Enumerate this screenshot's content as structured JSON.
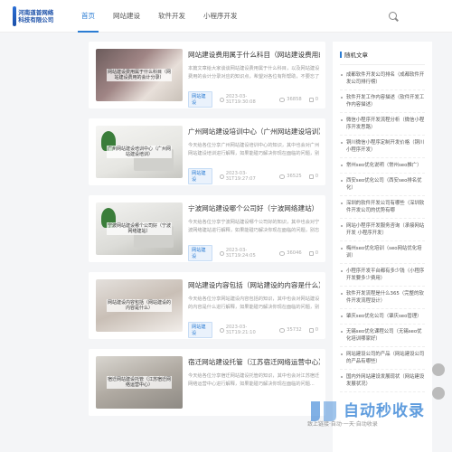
{
  "header": {
    "logo_text": "河南道普网络科技有限公司",
    "nav": [
      "首页",
      "网站建设",
      "软件开发",
      "小程序开发"
    ]
  },
  "articles": [
    {
      "title": "网站建设费用属于什么科目（网站建设费用的会计分录）",
      "excerpt": "本篇文章给大家谈谈网站建设费用属于什么科目，以及网站建设费用的会计分录对应的知识点，希望对各位有所帮助，不要忘了收藏本站喔。本文目录一览：1、建网站的费用在会计科目中应属于哪...",
      "thumb_label": "网站建设费用属于什么科目（网站建设费用的会计分录）",
      "tag": "网站建设",
      "date": "2023-03-31T19:30:08",
      "views": "36858",
      "comments": "0"
    },
    {
      "title": "广州网站建设培训中心（广州网站建设培训）",
      "excerpt": "今天给各位分享广州网站建设培训中心的知识，其中也会对广州网站建设培训进行解释，如果能碰巧解决你现在面临的问题，别忘了关注本站，现在开始吧！本文目录一览：1、广州番禺化妆培训机构...",
      "thumb_label": "广州网站建设培训中心（广州网站建设培训）",
      "tag": "网站建设",
      "date": "2023-03-31T19:27:07",
      "views": "36525",
      "comments": "0"
    },
    {
      "title": "宁波网站建设哪个公司好（宁波网络建站）",
      "excerpt": "今天给各位分享宁波网站建设哪个公司好的知识，其中也会对宁波网络建站进行解释，如果能碰巧解决你现在面临的问题，别忘了关注本站，现在开始吧！本文目录一览：1、宁波建网站制作哪家好...",
      "thumb_label": "宁波网站建设哪个公司好（宁波网络建站）",
      "tag": "网站建设",
      "date": "2023-03-31T19:24:05",
      "views": "36046",
      "comments": "0"
    },
    {
      "title": "网站建设内容包括（网站建设的内容是什么）",
      "excerpt": "今天给各位分享网站建设内容包括的知识，其中也会对网站建设的内容是什么进行解释，如果能碰巧解决你现在面临的问题，别忘了关注本站，现在开始吧！本文目录一览：1、网站建设包括哪些...",
      "thumb_label": "网站建设内容包括（网站建设的内容是什么）",
      "tag": "网站建设",
      "date": "2023-03-31T19:21:10",
      "views": "35732",
      "comments": "0"
    },
    {
      "title": "宿迁网站建设托管（江苏宿迁网络运营中心）",
      "excerpt": "今天给各位分享宿迁网站建设托管的知识，其中也会对江苏宿迁网络运营中心进行解释，如果能碰巧解决你现在面临的问题...",
      "thumb_label": "宿迁网站建设托管（江苏宿迁网络运营中心）",
      "tag": "网站建设",
      "date": "2023-03-31T19:18:02",
      "views": "35410",
      "comments": "0"
    }
  ],
  "sidebar": {
    "title": "随机文章",
    "items": [
      "成都软件开发公司排名（成都软件开发公司排行榜）",
      "软件开发工作内容描述（软件开发工作内容描述）",
      "微信小程序开发流程分析（微信小程序开发思路）",
      "铜川微信小程序定制开发价格（铜川小程序开发）",
      "常州seo优化说明（常州seo推广）",
      "西安seo优化公司（西安seo排名优化）",
      "深圳的软件开发公司有哪些（深圳软件开发公司的优势有哪",
      "网站小程序开发服务咨询（承接网站开发 小程序开发）",
      "梅州seo优化培训（seo网站优化培训）",
      "小程序开发平台都有多少钱（小程序开发要多少费用）",
      "软件开发流程是什么365（完整的软件开发流程设计）",
      "肇庆seo优化公司（肇庆seo管理）",
      "无锡seo优化课程公司（无锡seo优化培训哪家好）",
      "网站建设公司的产品（网站建设公司的产品有哪些）",
      "国内外网站建设发展现状（网站建设发展状况）"
    ]
  },
  "watermark": {
    "text": "自动秒收录",
    "sub": "致上链接·自动·一天·自动收录"
  }
}
